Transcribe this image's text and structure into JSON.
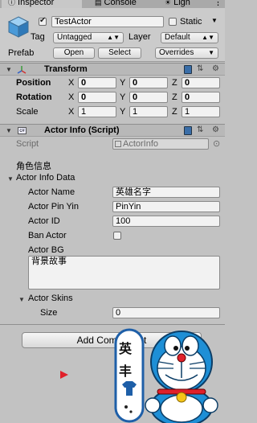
{
  "tabs": {
    "inspector": "Inspector",
    "console": "Console",
    "lighting": "Ligh"
  },
  "header": {
    "active_checked": true,
    "object_name": "TestActor",
    "static_label": "Static",
    "tag_label": "Tag",
    "tag_value": "Untagged",
    "layer_label": "Layer",
    "layer_value": "Default",
    "prefab_label": "Prefab",
    "open": "Open",
    "select": "Select",
    "overrides": "Overrides"
  },
  "transform": {
    "title": "Transform",
    "rows": [
      {
        "label": "Position",
        "x": "0",
        "y": "0",
        "z": "0"
      },
      {
        "label": "Rotation",
        "x": "0",
        "y": "0",
        "z": "0"
      },
      {
        "label": "Scale",
        "x": "1",
        "y": "1",
        "z": "1"
      }
    ],
    "axis": {
      "x": "X",
      "y": "Y",
      "z": "Z"
    }
  },
  "actor_info": {
    "title": "Actor Info (Script)",
    "script_label": "Script",
    "script_value": "ActorInfo",
    "section_heading": "角色信息",
    "data_foldout": "Actor Info Data",
    "name_label": "Actor Name",
    "name_value": "英雄名字",
    "pinyin_label": "Actor Pin Yin",
    "pinyin_value": "PinYin",
    "id_label": "Actor ID",
    "id_value": "100",
    "ban_label": "Ban Actor",
    "ban_checked": false,
    "bg_label": "Actor BG",
    "bg_value": "背景故事",
    "skins_foldout": "Actor Skins",
    "size_label": "Size",
    "size_value": "0",
    "add_component": "Add Component"
  },
  "sticker": {
    "chars": [
      "英",
      "丰"
    ]
  },
  "colors": {
    "header_bg": "#cbcbcb",
    "body_bg": "#c2c2c2",
    "doraemon_blue": "#1e8fd6",
    "cursor_red": "#e0202a"
  }
}
